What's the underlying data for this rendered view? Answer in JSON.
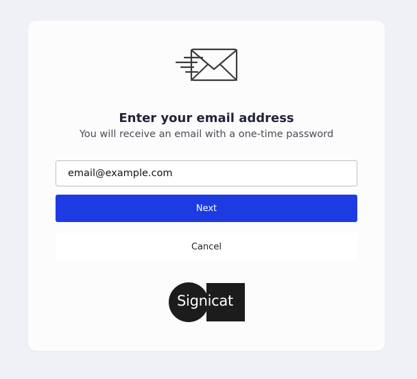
{
  "header": {
    "title": "Enter your email address",
    "subtitle": "You will receive an email with a one-time password"
  },
  "form": {
    "email_value": "email@example.com",
    "next_label": "Next",
    "cancel_label": "Cancel"
  },
  "branding": {
    "logo_text": "Signicat",
    "icon": "envelope-send-icon"
  },
  "colors": {
    "primary": "#1d3be2",
    "background": "#f0f1f6",
    "card": "#fcfcfc",
    "logo": "#1c1c1c"
  }
}
